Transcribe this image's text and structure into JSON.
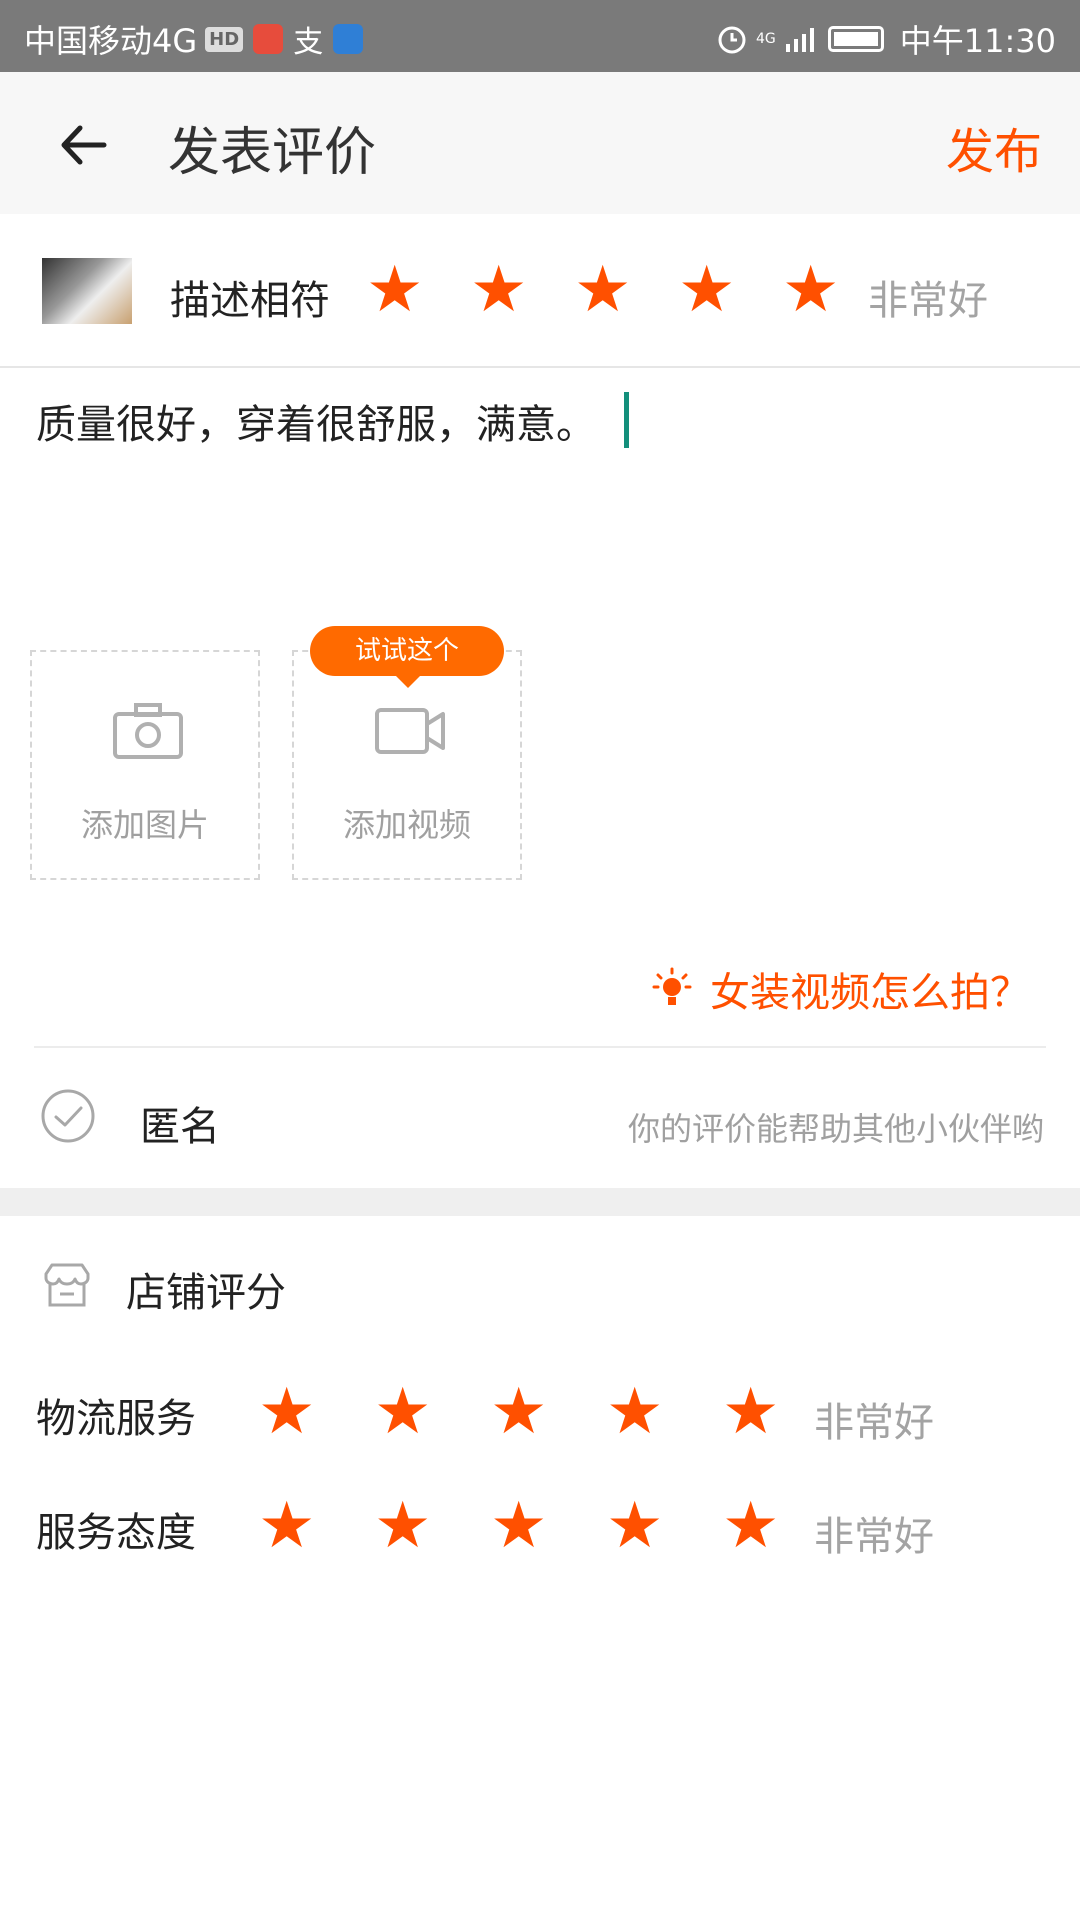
{
  "status_bar": {
    "carrier": "中国移动4G",
    "hd_badge": "HD",
    "network": "4G",
    "time": "中午11:30"
  },
  "header": {
    "title": "发表评价",
    "publish": "发布"
  },
  "item_rating": {
    "label": "描述相符",
    "stars": 5,
    "max_stars": 5,
    "text": "非常好"
  },
  "review": {
    "text": "质量很好，穿着很舒服，满意。"
  },
  "media": {
    "add_photo": "添加图片",
    "add_video": "添加视频",
    "tip": "试试这个"
  },
  "help_link": "女装视频怎么拍？",
  "anonymous": {
    "label": "匿名",
    "hint": "你的评价能帮助其他小伙伴哟"
  },
  "shop": {
    "title": "店铺评分",
    "rows": [
      {
        "label": "物流服务",
        "stars": 5,
        "text": "非常好"
      },
      {
        "label": "服务态度",
        "stars": 5,
        "text": "非常好"
      }
    ]
  },
  "colors": {
    "accent": "#ff5000",
    "cursor": "#138f7b",
    "muted": "#a0a0a0"
  }
}
